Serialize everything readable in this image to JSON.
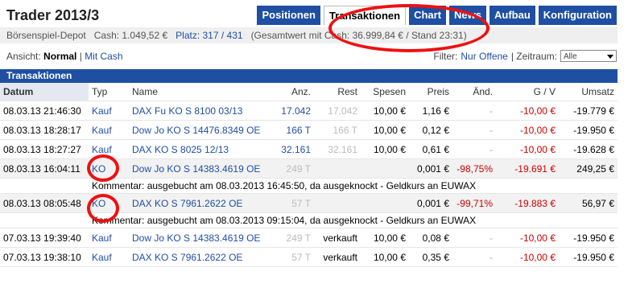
{
  "header": {
    "title": "Trader 2013/3",
    "tabs": [
      "Positionen",
      "Transaktionen",
      "Chart",
      "News",
      "Aufbau",
      "Konfiguration"
    ]
  },
  "info": {
    "depot": "Börsenspiel-Depot",
    "cash": "Cash: 1.049,52 €",
    "platz": "Platz: 317 / 431",
    "gesamt": "(Gesamtwert mit Cash: 36.999,84 € / Stand 23:31)"
  },
  "view": {
    "label": "Ansicht:",
    "normal": "Normal",
    "sep": "|",
    "mitcash": "Mit Cash"
  },
  "filter": {
    "label": "Filter:",
    "nur_offene": "Nur Offene",
    "zeitraum": "| Zeitraum:",
    "select_value": "Alle"
  },
  "panel_title": "Transaktionen",
  "table": {
    "headers": [
      "Datum",
      "Typ",
      "Name",
      "Anz.",
      "Rest",
      "Spesen",
      "Preis",
      "Änd.",
      "G / V",
      "Umsatz"
    ],
    "rows": [
      {
        "datum": "08.03.13 21:46:30",
        "typ": "Kauf",
        "name": "DAX Fu KO S 8100 03/13",
        "anz": "17.042",
        "rest": "17.042",
        "spesen": "10,00 €",
        "preis": "1,16 €",
        "aend": "-",
        "gv": "-10,00 €",
        "umsatz": "-19.779 €"
      },
      {
        "datum": "08.03.13 18:28:17",
        "typ": "Kauf",
        "name": "Dow Jo KO S 14476.8349 OE",
        "anz": "166 T",
        "rest": "166 T",
        "spesen": "10,00 €",
        "preis": "0,12 €",
        "aend": "-",
        "gv": "-10,00 €",
        "umsatz": "-19.950 €"
      },
      {
        "datum": "08.03.13 18:27:27",
        "typ": "Kauf",
        "name": "DAX KO S 8025 12/13",
        "anz": "32.161",
        "rest": "32.161",
        "spesen": "10,00 €",
        "preis": "0,61 €",
        "aend": "-",
        "gv": "-10,00 €",
        "umsatz": "-19.628 €"
      },
      {
        "datum": "08.03.13 16:04:11",
        "typ": "KO",
        "name": "Dow Jo KO S 14383.4619 OE",
        "anz": "249 T",
        "rest": "",
        "spesen": "",
        "preis": "0,001 €",
        "aend": "-98,75%",
        "gv": "-19.691 €",
        "umsatz": "249,25 €",
        "comment": "Kommentar: ausgebucht am 08.03.2013 16:45:50, da ausgeknockt - Geldkurs an EUWAX"
      },
      {
        "datum": "08.03.13 08:05:48",
        "typ": "KO",
        "name": "DAX KO S 7961.2622 OE",
        "anz": "57 T",
        "rest": "",
        "spesen": "",
        "preis": "0,001 €",
        "aend": "-99,71%",
        "gv": "-19.883 €",
        "umsatz": "56,97 €",
        "comment": "Kommentar: ausgebucht am 08.03.2013 09:15:04, da ausgeknockt - Geldkurs an EUWAX"
      },
      {
        "datum": "07.03.13 19:39:40",
        "typ": "Kauf",
        "name": "Dow Jo KO S 14383.4619 OE",
        "anz": "249 T",
        "rest": "verkauft",
        "spesen": "10,00 €",
        "preis": "0,08 €",
        "aend": "-",
        "gv": "-10,00 €",
        "umsatz": "-19.950 €"
      },
      {
        "datum": "07.03.13 19:38:10",
        "typ": "Kauf",
        "name": "DAX KO S 7961.2622 OE",
        "anz": "57 T",
        "rest": "verkauft",
        "spesen": "10,00 €",
        "preis": "0,35 €",
        "aend": "-",
        "gv": "-10,00 €",
        "umsatz": "-19.950 €"
      }
    ]
  }
}
